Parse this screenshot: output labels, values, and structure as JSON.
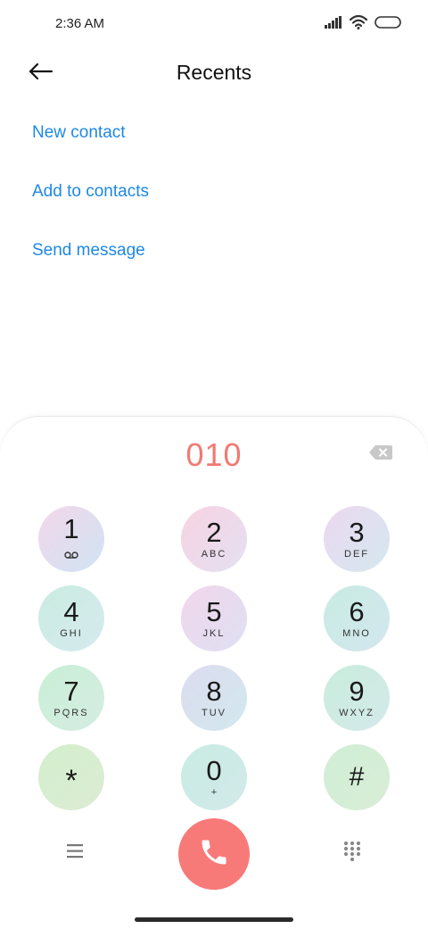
{
  "status_bar": {
    "time": "2:36 AM",
    "icons": [
      "signal-icon",
      "wifi-icon",
      "battery-icon"
    ]
  },
  "header": {
    "title": "Recents",
    "back_icon": "arrow-left-icon"
  },
  "actions": [
    {
      "label": "New contact"
    },
    {
      "label": "Add to contacts"
    },
    {
      "label": "Send message"
    }
  ],
  "dialpad": {
    "dialed_number": "010",
    "backspace_icon": "backspace-icon",
    "keys": [
      {
        "digit": "1",
        "letters": "",
        "sub_icon": "voicemail-icon"
      },
      {
        "digit": "2",
        "letters": "ABC"
      },
      {
        "digit": "3",
        "letters": "DEF"
      },
      {
        "digit": "4",
        "letters": "GHI"
      },
      {
        "digit": "5",
        "letters": "JKL"
      },
      {
        "digit": "6",
        "letters": "MNO"
      },
      {
        "digit": "7",
        "letters": "PQRS"
      },
      {
        "digit": "8",
        "letters": "TUV"
      },
      {
        "digit": "9",
        "letters": "WXYZ"
      },
      {
        "digit": "*",
        "letters": ""
      },
      {
        "digit": "0",
        "letters": "+"
      },
      {
        "digit": "#",
        "letters": ""
      }
    ],
    "bottom_icons": [
      "menu-icon",
      "phone-icon",
      "dialpad-grid-icon"
    ]
  },
  "colors": {
    "accent_link": "#1e88e5",
    "dialed_number": "#f07a72",
    "call_button": "#f77a79"
  }
}
